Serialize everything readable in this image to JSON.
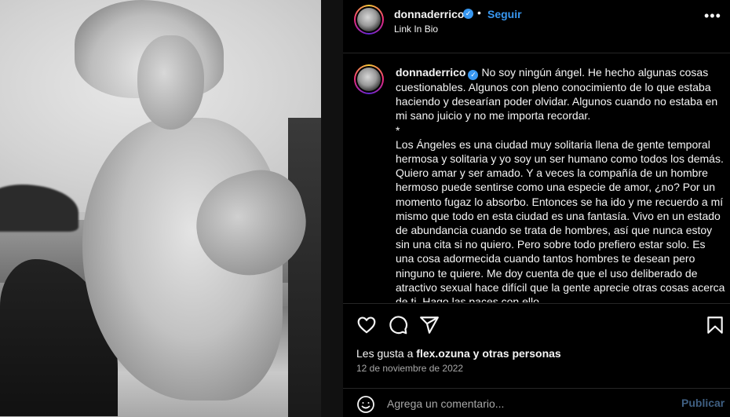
{
  "post": {
    "username": "donnaderrico",
    "follow_label": "Seguir",
    "separator": "•",
    "subtitle": "Link In Bio",
    "more_label": "•••"
  },
  "caption": {
    "username": "donnaderrico",
    "paragraphs": [
      "No soy ningún ángel. He hecho algunas cosas cuestionables. Algunos con pleno conocimiento de lo que estaba haciendo y desearían poder olvidar. Algunos cuando no estaba en mi sano juicio y no me importa recordar.",
      "*",
      "Los Ángeles es una ciudad muy solitaria llena de gente temporal hermosa y solitaria y yo soy un ser humano como todos los demás. Quiero amar y ser amado. Y a veces la compañía de un hombre hermoso puede sentirse como una especie de amor, ¿no? Por un momento fugaz lo absorbo. Entonces se ha ido y me recuerdo a mí mismo que todo en esta ciudad es una fantasía. Vivo en un estado de abundancia cuando se trata de hombres, así que nunca estoy sin una cita si no quiero. Pero sobre todo prefiero estar solo. Es una cosa adormecida cuando tantos hombres te desean pero ninguno te quiere. Me doy cuenta de que el uso deliberado de atractivo sexual hace difícil que la gente aprecie otras cosas acerca de ti. Hago las paces con ello."
    ]
  },
  "likes": {
    "prefix": "Les gusta a",
    "user": "flex.ozuna",
    "suffix": "y otras personas"
  },
  "date": "12 de noviembre de 2022",
  "comment": {
    "placeholder": "Agrega un comentario...",
    "publish_label": "Publicar"
  },
  "colors": {
    "background": "#000000",
    "link_blue": "#3897f0",
    "publish_disabled": "#3f5f82",
    "muted": "#a8a8a8"
  },
  "icons": [
    "verified-badge-icon",
    "more-options-icon",
    "heart-icon",
    "comment-icon",
    "share-icon",
    "bookmark-icon",
    "emoji-icon"
  ]
}
